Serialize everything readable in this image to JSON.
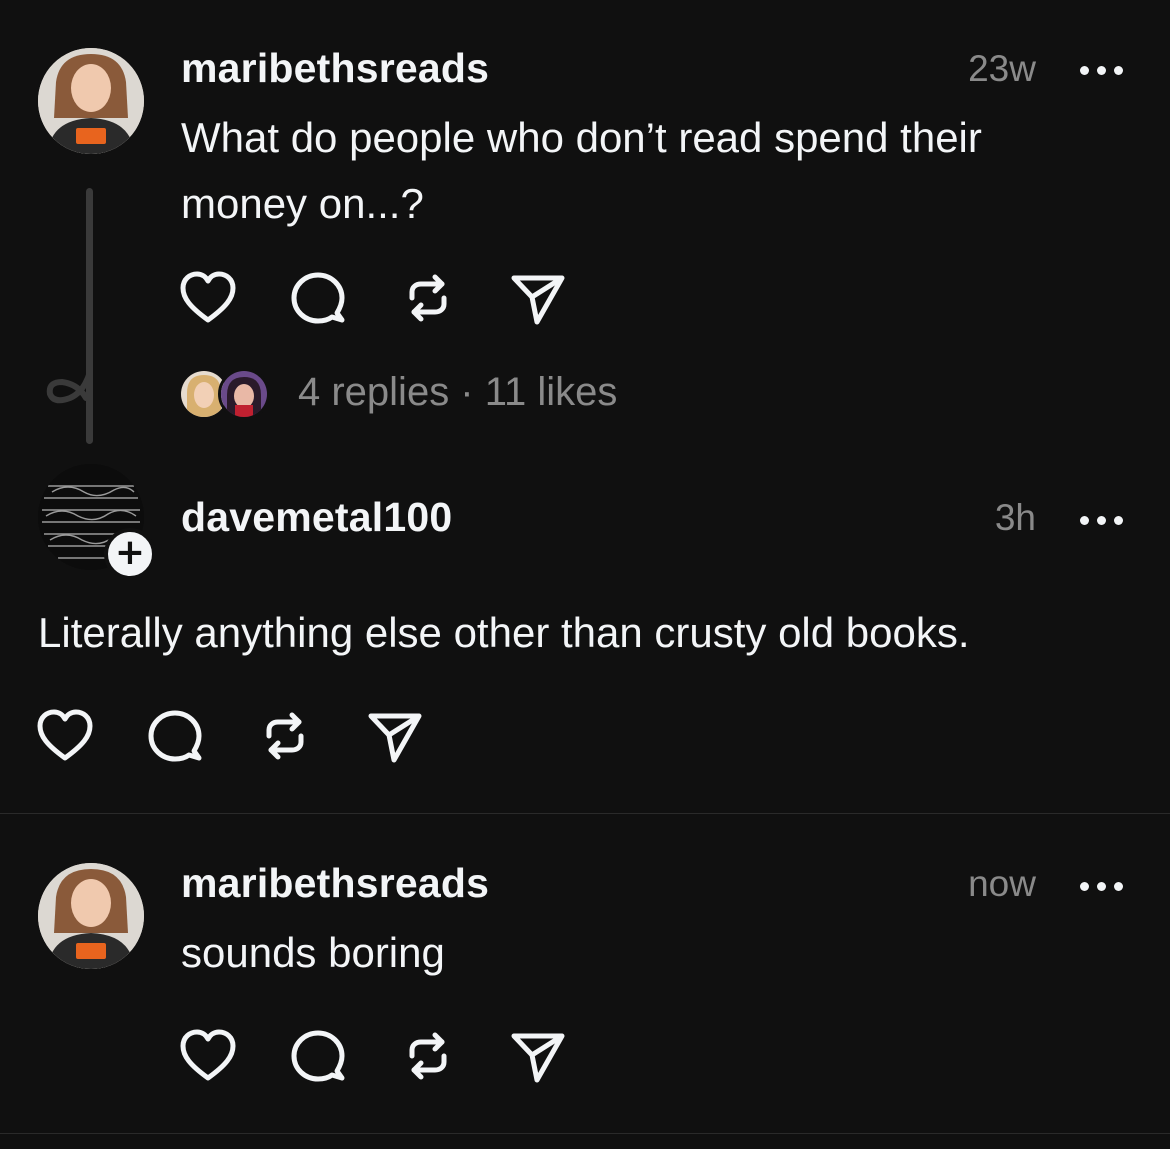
{
  "posts": [
    {
      "username": "maribethsreads",
      "time": "23w",
      "text_line1": "What do people who don’t read spend their",
      "text_line2": "money on...?",
      "meta": "4 replies · 11 likes"
    },
    {
      "username": "davemetal100",
      "time": "3h",
      "text": "Literally anything else other than crusty old books."
    },
    {
      "username": "maribethsreads",
      "time": "now",
      "text": "sounds boring"
    }
  ],
  "icons": {
    "like": "heart-icon",
    "reply": "comment-icon",
    "repost": "repost-icon",
    "share": "send-icon",
    "more": "more-icon",
    "follow": "plus-icon"
  },
  "colors": {
    "background": "#101010",
    "text": "#f3f5f7",
    "muted": "#8a8a8a",
    "shirt_accent": "#e8641e"
  }
}
